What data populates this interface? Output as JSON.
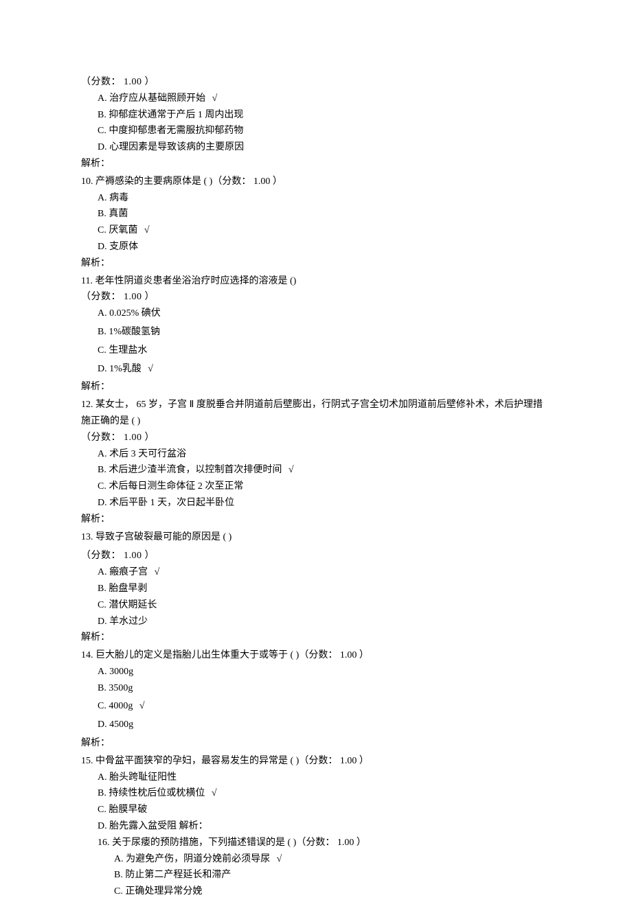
{
  "score_prefix": "（分数： ",
  "score_value": "1.00",
  "score_suffix": " ）",
  "checkmark": "√",
  "analysis_label": "解析：",
  "q9": {
    "opts": {
      "A": "A.  治疗应从基础照顾开始",
      "B": "B.  抑郁症状通常于产后 1 周内出现",
      "C": "C. 中度抑郁患者无需服抗抑郁药物",
      "D": "D.  心理因素是导致该病的主要原因"
    }
  },
  "q10": {
    "stem": "10.  产褥感染的主要病原体是 ( )（分数： 1.00 ）",
    "opts": {
      "A": "A.  病毒",
      "B": "B.  真菌",
      "C": "C.  厌氧菌",
      "D": "D.  支原体"
    }
  },
  "q11": {
    "stem": "11.  老年性阴道炎患者坐浴治疗时应选择的溶液是 ()",
    "opts": {
      "A": "A.  0.025% 碘伏",
      "B": "B.  1%碳酸氢钠",
      "C": "C.  生理盐水",
      "D": "D.  1%乳酸"
    }
  },
  "q12": {
    "stem": "12.  某女士， 65 岁，子宫 Ⅱ 度脱垂合并阴道前后壁膨出，行阴式子宫全切术加阴道前后壁修补术，术后护理措施正确的是 ( )",
    "opts": {
      "A": "A.  术后 3 天可行盆浴",
      "B": "B.  术后进少渣半流食，以控制首次排便时间",
      "C": "C.  术后每日测生命体征 2 次至正常",
      "D": "D.  术后平卧 1 天，次日起半卧位"
    }
  },
  "q13": {
    "stem": "13.  导致子宫破裂最可能的原因是 ( )",
    "opts": {
      "A": "A.  瘢痕子宫",
      "B": "B.  胎盘早剥",
      "C": "C.  潜伏期延长",
      "D": "D.  羊水过少"
    }
  },
  "q14": {
    "stem": "14.  巨大胎儿的定义是指胎儿出生体重大于或等于 ( )（分数： 1.00 ）",
    "opts": {
      "A": "A.  3000g",
      "B": "B.  3500g",
      "C": "C.  4000g",
      "D": "D.  4500g"
    }
  },
  "q15": {
    "stem": "15.  中骨盆平面狭窄的孕妇，最容易发生的异常是 ( )（分数： 1.00 ）",
    "opts": {
      "A": "A.  胎头跨耻征阳性",
      "B": "B.  持续性枕后位或枕横位",
      "C": "C.  胎膜早破",
      "D": "D.  胎先露入盆受阻 解析："
    }
  },
  "q16": {
    "stem": "16.  关于尿瘘的预防措施，下列描述错误的是 ( )（分数： 1.00 ）",
    "opts": {
      "A": "A.  为避免产伤，阴道分娩前必须导尿",
      "B": "B.  防止第二产程延长和滞产",
      "C": "C.  正确处理异常分娩"
    }
  }
}
